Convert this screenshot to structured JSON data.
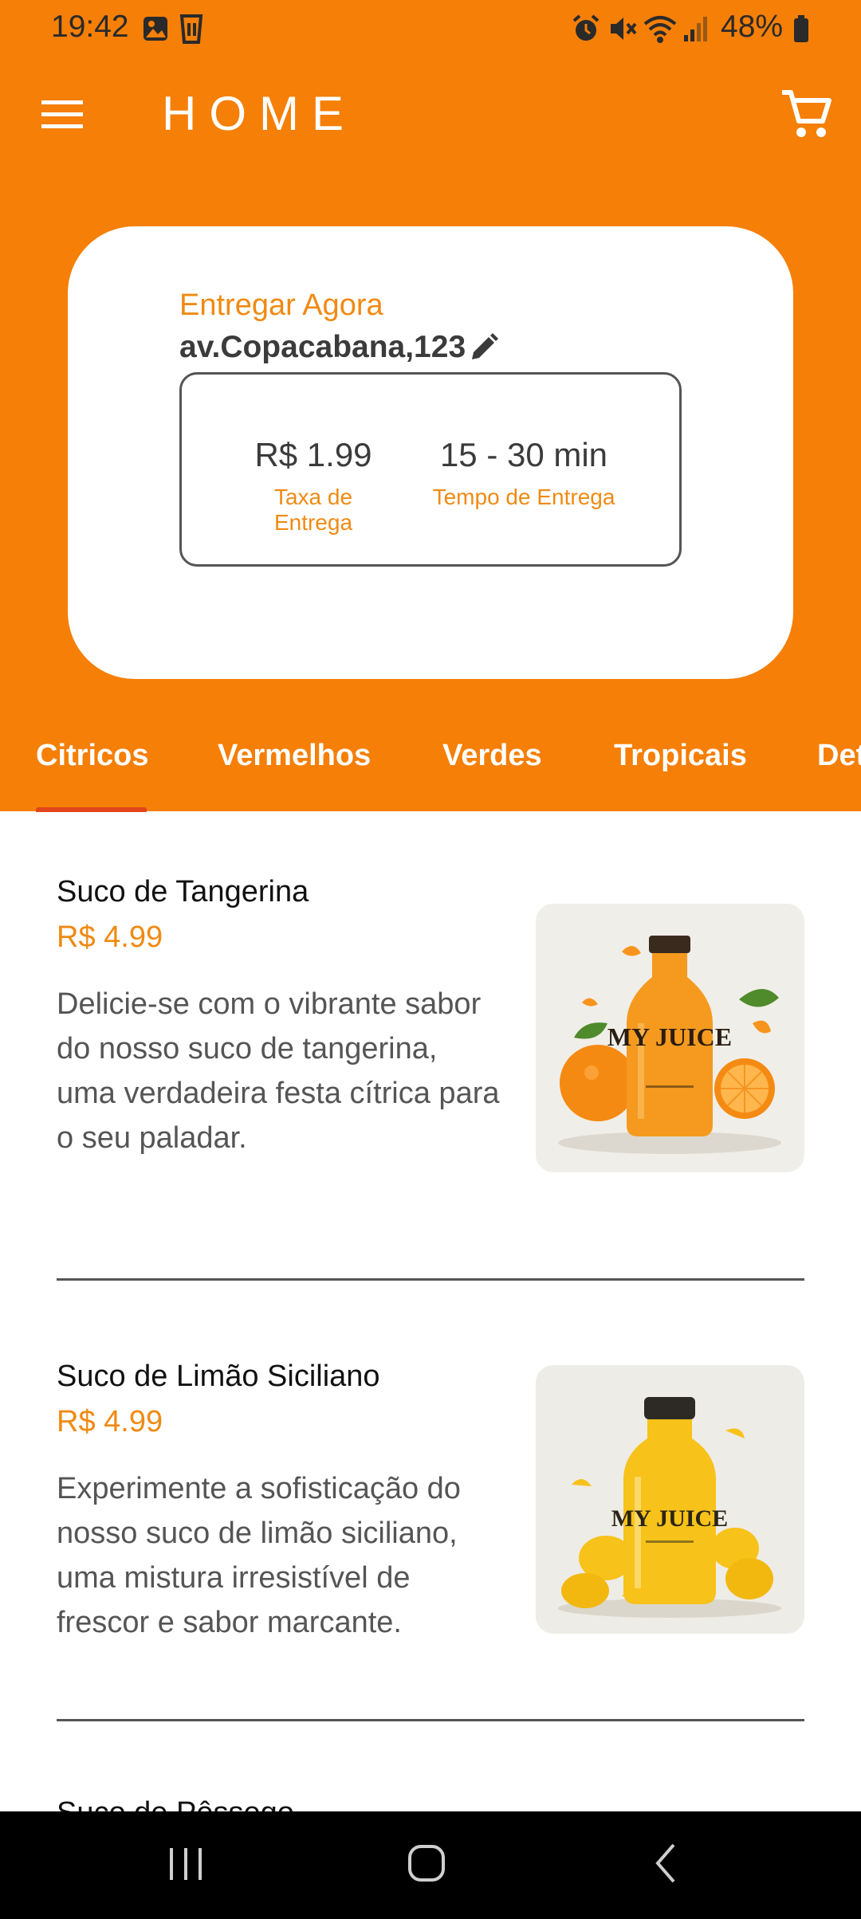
{
  "status_bar": {
    "time": "19:42",
    "battery": "48%",
    "left_icons": [
      "gallery-icon",
      "cup-icon"
    ],
    "right_icons": [
      "alarm-icon",
      "mute-icon",
      "wifi-icon",
      "signal-icon",
      "battery-icon"
    ]
  },
  "app_bar": {
    "title": "HOME",
    "menu_icon": "hamburger-menu-icon",
    "cart_icon": "shopping-cart-icon"
  },
  "delivery": {
    "heading": "Entregar Agora",
    "address": "av.Copacabana,123",
    "fee_value": "R$ 1.99",
    "fee_label": "Taxa de Entrega",
    "time_value": "15 - 30 min",
    "time_label": "Tempo de Entrega"
  },
  "tabs": [
    {
      "label": "Citricos",
      "selected": true
    },
    {
      "label": "Vermelhos",
      "selected": false
    },
    {
      "label": "Verdes",
      "selected": false
    },
    {
      "label": "Tropicais",
      "selected": false
    },
    {
      "label": "Det",
      "selected": false
    }
  ],
  "products": [
    {
      "name": "Suco de Tangerina",
      "price": "R$ 4.99",
      "description": "Delicie-se com o vibrante sabor do nosso suco de tangerina, uma verdadeira festa cítrica para o seu paladar.",
      "image_label": "MY JUICE"
    },
    {
      "name": "Suco de Limão Siciliano",
      "price": "R$ 4.99",
      "description": "Experimente a sofisticação do nosso suco de limão siciliano, uma mistura irresistível de frescor e sabor marcante.",
      "image_label": "MY JUICE"
    },
    {
      "name": "Suco de Pêssego"
    }
  ],
  "colors": {
    "primary": "#f57f07",
    "accent_text": "#f08a13",
    "tab_indicator": "#e2451b"
  },
  "nav_bar": {
    "icons": [
      "recent-apps-icon",
      "home-icon",
      "back-icon"
    ]
  }
}
